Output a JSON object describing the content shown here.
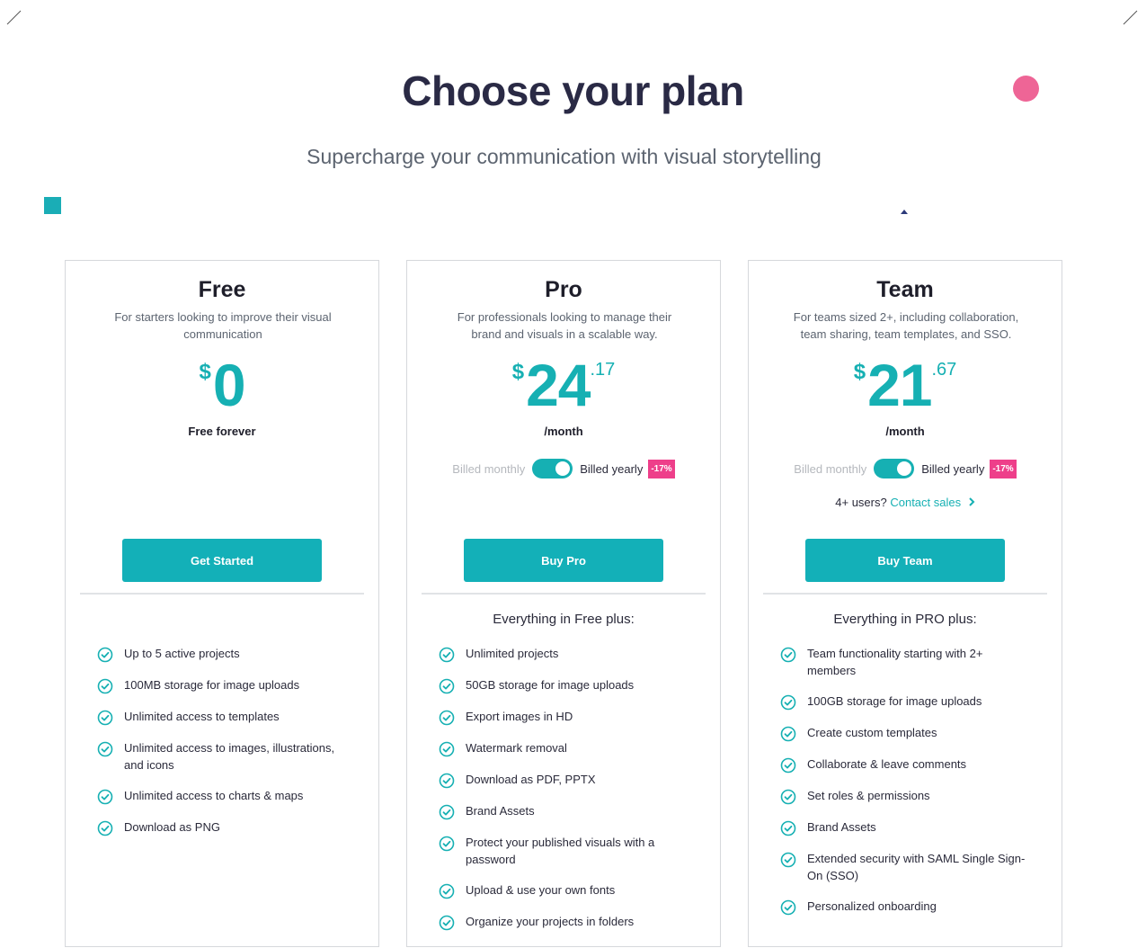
{
  "colors": {
    "accent": "#13b0b8",
    "pink": "#ee6596",
    "discount": "#ee3f8a"
  },
  "header": {
    "title": "Choose your plan",
    "subtitle": "Supercharge your communication with visual storytelling"
  },
  "plans": {
    "free": {
      "name": "Free",
      "description": "For starters looking to improve their visual communication",
      "currency": "$",
      "amount": "0",
      "cents": "",
      "period": "Free forever",
      "cta": "Get Started",
      "features_heading": "",
      "features": [
        "Up to 5 active projects",
        "100MB storage for image uploads",
        "Unlimited access to templates",
        "Unlimited access to images, illustrations, and icons",
        "Unlimited access to charts & maps",
        "Download as PNG"
      ]
    },
    "pro": {
      "name": "Pro",
      "description": "For professionals looking to manage their brand and visuals in a scalable way.",
      "currency": "$",
      "amount": "24",
      "cents": ".17",
      "period": "/month",
      "billing_monthly": "Billed monthly",
      "billing_yearly": "Billed yearly",
      "discount": "-17%",
      "cta": "Buy Pro",
      "features_heading": "Everything in Free plus:",
      "features": [
        "Unlimited projects",
        "50GB storage for image uploads",
        "Export images in HD",
        "Watermark removal",
        "Download as PDF, PPTX",
        "Brand Assets",
        "Protect your published visuals with a password",
        "Upload & use your own fonts",
        "Organize your projects in folders"
      ]
    },
    "team": {
      "name": "Team",
      "description": "For teams sized 2+, including collaboration, team sharing, team templates, and SSO.",
      "currency": "$",
      "amount": "21",
      "cents": ".67",
      "period": "/month",
      "billing_monthly": "Billed monthly",
      "billing_yearly": "Billed yearly",
      "discount": "-17%",
      "contact_prefix": "4+ users?",
      "contact_link": "Contact sales",
      "cta": "Buy Team",
      "features_heading": "Everything in PRO plus:",
      "features": [
        "Team functionality starting with 2+ members",
        "100GB storage for image uploads",
        "Create custom templates",
        "Collaborate & leave comments",
        "Set roles & permissions",
        "Brand Assets",
        "Extended security with SAML Single Sign-On (SSO)",
        "Personalized onboarding"
      ]
    }
  }
}
